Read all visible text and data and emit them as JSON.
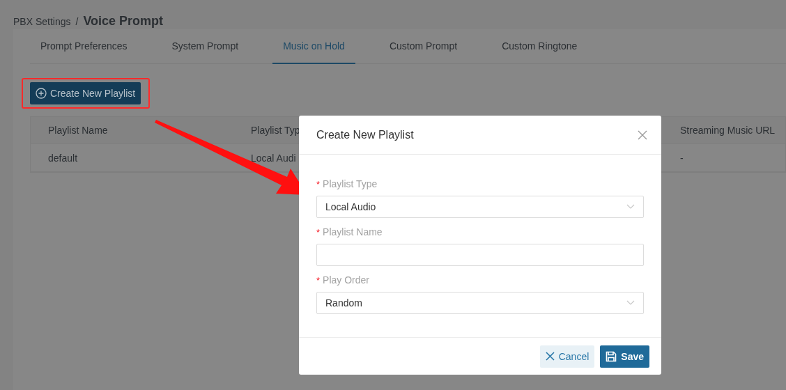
{
  "breadcrumb": {
    "parent": "PBX Settings",
    "separator": "/",
    "current": "Voice Prompt"
  },
  "tabs": [
    {
      "label": "Prompt Preferences",
      "selected": false
    },
    {
      "label": "System Prompt",
      "selected": false
    },
    {
      "label": "Music on Hold",
      "selected": true
    },
    {
      "label": "Custom Prompt",
      "selected": false
    },
    {
      "label": "Custom Ringtone",
      "selected": false
    }
  ],
  "create_button": {
    "label": "Create New Playlist"
  },
  "table": {
    "columns": [
      "Playlist Name",
      "Playlist Typ",
      "Streaming Music URL"
    ],
    "rows": [
      [
        "default",
        "Local Audi",
        "-"
      ]
    ]
  },
  "dialog": {
    "title": "Create New Playlist",
    "fields": [
      {
        "label": "Playlist Type",
        "required_mark": "*",
        "kind": "select",
        "value": "Local Audio"
      },
      {
        "label": "Playlist Name",
        "required_mark": "*",
        "kind": "input"
      },
      {
        "label": "Play Order",
        "required_mark": "*",
        "kind": "select",
        "value": "Random"
      }
    ],
    "buttons": [
      {
        "label": "Cancel",
        "kind": "cancel"
      },
      {
        "label": "Save",
        "kind": "save"
      }
    ]
  }
}
